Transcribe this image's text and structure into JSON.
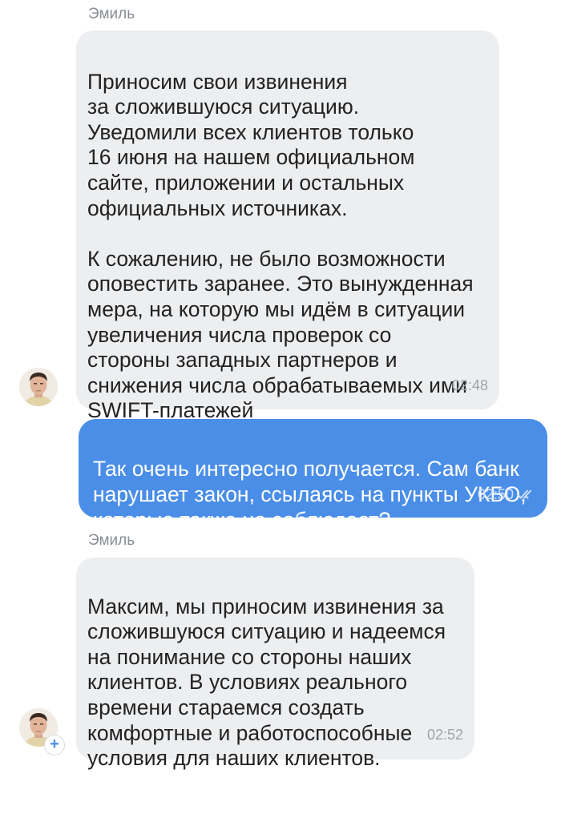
{
  "messages": [
    {
      "sender": "Эмиль",
      "text": "Приносим свои извинения\nза сложившуюся ситуацию.\nУведомили всех клиентов только\n16 июня на нашем официальном\nсайте, приложении и остальных\nофициальных источниках.\n\nК сожалению, не было возможности\nоповестить заранее. Это вынужденная\nмера, на которую мы идём в ситуации\nувеличения числа проверок со\nстороны западных партнеров и\nснижения числа обрабатываемых ими\nSWIFT-платежей",
      "time": "02:48"
    },
    {
      "text": "Так очень интересно получается. Сам банк\nнарушает закон, ссылаясь на пункты УКБО,\nкоторые также не соблюдает?",
      "time": "02:50"
    },
    {
      "sender": "Эмиль",
      "text": "Максим, мы приносим извинения за\nсложившуюся ситуацию и надеемся\nна понимание со стороны наших\nклиентов. В условиях реального\nвремени стараемся создать\nкомфортные и работоспособные\nусловия для наших клиентов.",
      "time": "02:52"
    }
  ],
  "badge": {
    "add_symbol": "+"
  },
  "colors": {
    "incoming_bubble": "#edeef0",
    "outgoing_bubble": "#4a8ee8",
    "timestamp": "#9ea4ab",
    "sender_name": "#8a8f96"
  }
}
